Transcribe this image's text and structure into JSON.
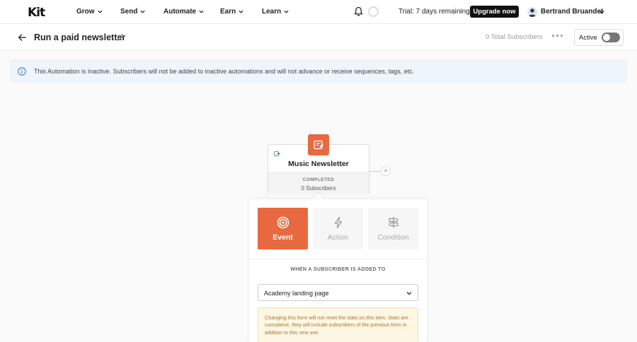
{
  "nav": {
    "logo": "Kit",
    "items": [
      {
        "label": "Grow"
      },
      {
        "label": "Send"
      },
      {
        "label": "Automate"
      },
      {
        "label": "Earn"
      },
      {
        "label": "Learn"
      }
    ],
    "trial_text": "Trial: 7 days remaining",
    "upgrade_label": "Upgrade now",
    "user_name": "Bertrand Bruandet"
  },
  "titlebar": {
    "title": "Run a paid newsletter",
    "total_subscribers": "0 Total Subscribers",
    "active_label": "Active",
    "active_on": false
  },
  "banner": {
    "text": "This Automation is inactive. Subscribers will not be added to inactive automations and will not advance or receive sequences, tags, etc."
  },
  "node": {
    "name": "Music Newsletter",
    "status": "COMPLETED",
    "subscribers": "0 Subscribers",
    "add_symbol": "+"
  },
  "panel": {
    "tabs": [
      {
        "label": "Event",
        "icon": "target-icon",
        "active": true
      },
      {
        "label": "Action",
        "icon": "lightning-icon",
        "active": false
      },
      {
        "label": "Condition",
        "icon": "signpost-icon",
        "active": false
      }
    ],
    "when_label": "WHEN A SUBSCRIBER IS ADDED TO",
    "selected_form": "Academy landing page",
    "warning": "Changing this form will not reset the stats on this item. Stats are cumulative, they will include subscribers of the previous form in addition to this new one."
  },
  "colors": {
    "accent": "#e8693f",
    "banner_bg": "#eef5fb",
    "warning_bg": "#fdf7e4",
    "warning_text": "#b0722a"
  }
}
